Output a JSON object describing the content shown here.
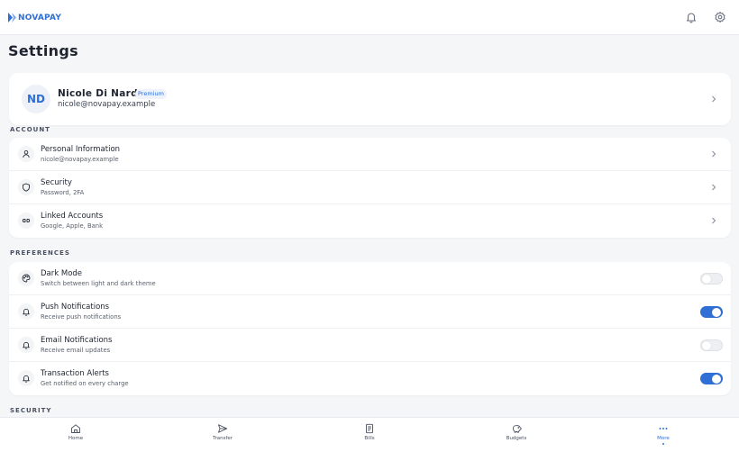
{
  "app": {
    "brand": "NOVAPAY",
    "brand_color": "#2f6fd6"
  },
  "header": {
    "icons": [
      "bell-icon",
      "gear-icon"
    ]
  },
  "page": {
    "title": "Settings"
  },
  "profile": {
    "initials": "ND",
    "name": "Nicole Di Nardo",
    "badge": "Premium",
    "email": "nicole@novapay.example"
  },
  "sections": {
    "account": {
      "label": "ACCOUNT",
      "items": [
        {
          "title": "Personal Information",
          "subtitle": "nicole@novapay.example",
          "icon": "user-icon"
        },
        {
          "title": "Security",
          "subtitle": "Password, 2FA",
          "icon": "shield-icon"
        },
        {
          "title": "Linked Accounts",
          "subtitle": "Google, Apple, Bank",
          "icon": "link-icon"
        }
      ]
    },
    "preferences": {
      "label": "PREFERENCES",
      "items": [
        {
          "title": "Dark Mode",
          "subtitle": "Switch between light and dark theme",
          "icon": "palette-icon",
          "enabled": false
        },
        {
          "title": "Push Notifications",
          "subtitle": "Receive push notifications",
          "icon": "bell-icon",
          "enabled": true
        },
        {
          "title": "Email Notifications",
          "subtitle": "Receive email updates",
          "icon": "bell-icon",
          "enabled": false
        },
        {
          "title": "Transaction Alerts",
          "subtitle": "Get notified on every charge",
          "icon": "bell-icon",
          "enabled": true
        }
      ]
    },
    "security": {
      "label": "SECURITY"
    }
  },
  "bottom_nav": {
    "items": [
      {
        "label": "Home",
        "icon": "home-icon"
      },
      {
        "label": "Transfer",
        "icon": "send-icon"
      },
      {
        "label": "Bills",
        "icon": "receipt-icon"
      },
      {
        "label": "Budgets",
        "icon": "piggy-bank-icon"
      },
      {
        "label": "More",
        "icon": "more-icon",
        "active": true
      }
    ]
  },
  "colors": {
    "accent": "#2f6fd6",
    "toggle_off": "#eeeff2",
    "background": "#f5f6f8"
  }
}
